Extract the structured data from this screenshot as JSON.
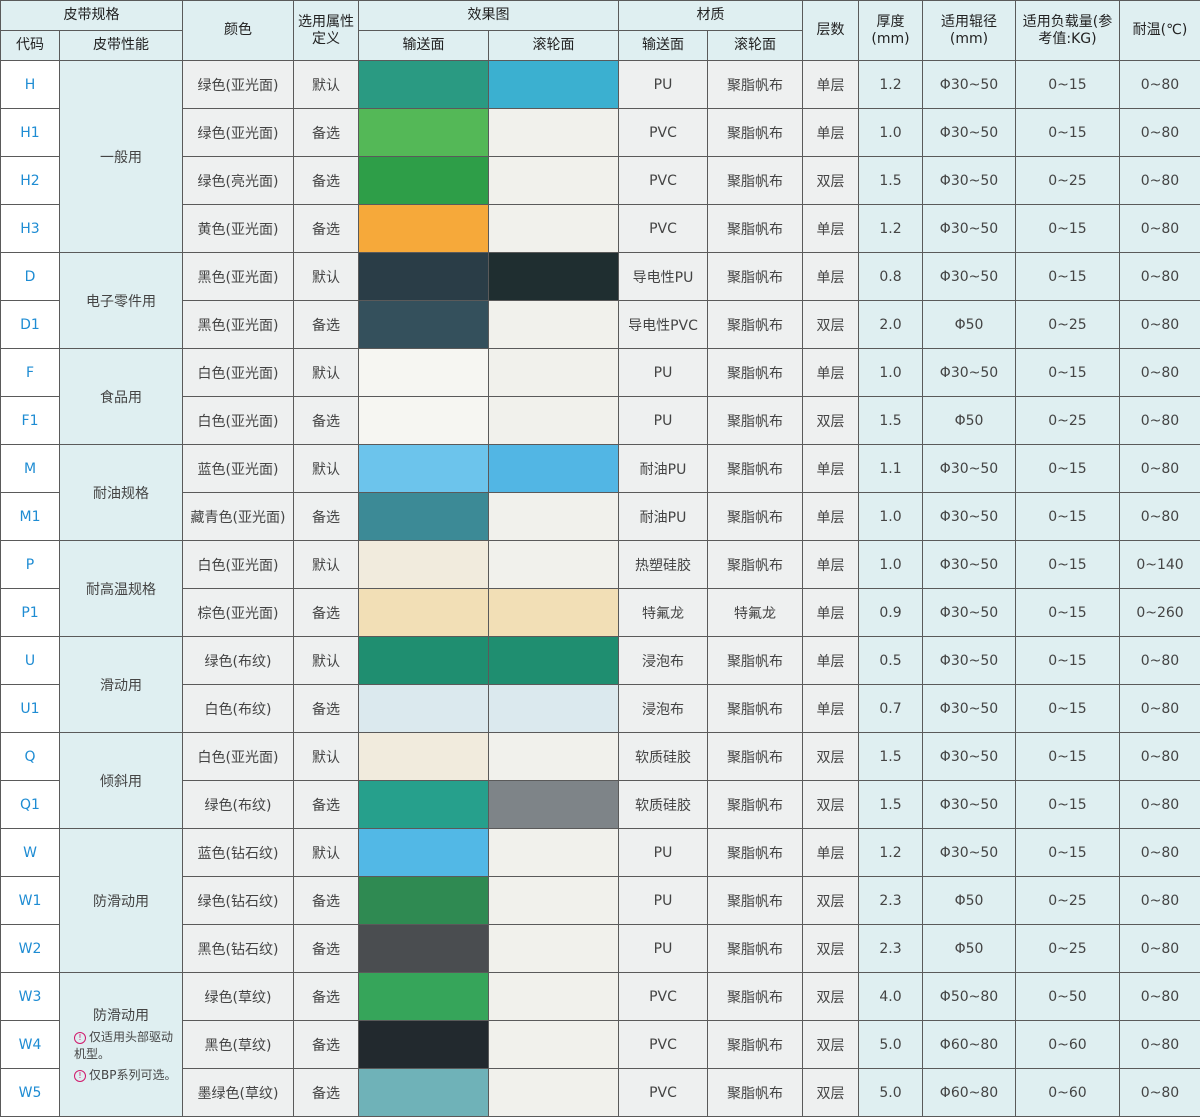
{
  "header": {
    "spec": "皮带规格",
    "code": "代码",
    "performance": "皮带性能",
    "color": "颜色",
    "attr": "选用属性定义",
    "effect": "效果图",
    "effect_conv": "输送面",
    "effect_roll": "滚轮面",
    "material": "材质",
    "mat_conv": "输送面",
    "mat_roll": "滚轮面",
    "layers": "层数",
    "thickness": "厚度(mm)",
    "radius": "适用辊径(mm)",
    "load": "适用负载量(参考值:KG)",
    "temp": "耐温(℃)"
  },
  "groups": [
    {
      "label": "一般用"
    },
    {
      "label": "电子零件用"
    },
    {
      "label": "食品用"
    },
    {
      "label": "耐油规格"
    },
    {
      "label": "耐高温规格"
    },
    {
      "label": "滑动用"
    },
    {
      "label": "倾斜用"
    },
    {
      "label": "防滑动用"
    },
    {
      "label": "防滑动用",
      "notes": [
        "仅适用头部驱动机型。",
        "仅BP系列可选。"
      ]
    }
  ],
  "rows": [
    {
      "code": "H",
      "color": "绿色(亚光面)",
      "attr": "默认",
      "mat_conv": "PU",
      "mat_roll": "聚脂帆布",
      "layers": "单层",
      "thickness": "1.2",
      "radius": "Φ30~50",
      "load": "0~15",
      "temp": "0~80",
      "sw_conv": "#2a9a82",
      "sw_roll": "#3bb0d0"
    },
    {
      "code": "H1",
      "color": "绿色(亚光面)",
      "attr": "备选",
      "mat_conv": "PVC",
      "mat_roll": "聚脂帆布",
      "layers": "单层",
      "thickness": "1.0",
      "radius": "Φ30~50",
      "load": "0~15",
      "temp": "0~80",
      "sw_conv": "#54b857",
      "sw_roll": "#f1f1ec"
    },
    {
      "code": "H2",
      "color": "绿色(亮光面)",
      "attr": "备选",
      "mat_conv": "PVC",
      "mat_roll": "聚脂帆布",
      "layers": "双层",
      "thickness": "1.5",
      "radius": "Φ30~50",
      "load": "0~25",
      "temp": "0~80",
      "sw_conv": "#2e9e48",
      "sw_roll": "#f1f1ec"
    },
    {
      "code": "H3",
      "color": "黄色(亚光面)",
      "attr": "备选",
      "mat_conv": "PVC",
      "mat_roll": "聚脂帆布",
      "layers": "单层",
      "thickness": "1.2",
      "radius": "Φ30~50",
      "load": "0~15",
      "temp": "0~80",
      "sw_conv": "#f6a93a",
      "sw_roll": "#f1f1ec"
    },
    {
      "code": "D",
      "color": "黑色(亚光面)",
      "attr": "默认",
      "mat_conv": "导电性PU",
      "mat_roll": "聚脂帆布",
      "layers": "单层",
      "thickness": "0.8",
      "radius": "Φ30~50",
      "load": "0~15",
      "temp": "0~80",
      "sw_conv": "#2a3d47",
      "sw_roll": "#1f2e30"
    },
    {
      "code": "D1",
      "color": "黑色(亚光面)",
      "attr": "备选",
      "mat_conv": "导电性PVC",
      "mat_roll": "聚脂帆布",
      "layers": "双层",
      "thickness": "2.0",
      "radius": "Φ50",
      "load": "0~25",
      "temp": "0~80",
      "sw_conv": "#34505c",
      "sw_roll": "#f1f1ec"
    },
    {
      "code": "F",
      "color": "白色(亚光面)",
      "attr": "默认",
      "mat_conv": "PU",
      "mat_roll": "聚脂帆布",
      "layers": "单层",
      "thickness": "1.0",
      "radius": "Φ30~50",
      "load": "0~15",
      "temp": "0~80",
      "sw_conv": "#f6f6f2",
      "sw_roll": "#f1f1ec"
    },
    {
      "code": "F1",
      "color": "白色(亚光面)",
      "attr": "备选",
      "mat_conv": "PU",
      "mat_roll": "聚脂帆布",
      "layers": "双层",
      "thickness": "1.5",
      "radius": "Φ50",
      "load": "0~25",
      "temp": "0~80",
      "sw_conv": "#f6f6f2",
      "sw_roll": "#f1f1ec"
    },
    {
      "code": "M",
      "color": "蓝色(亚光面)",
      "attr": "默认",
      "mat_conv": "耐油PU",
      "mat_roll": "聚脂帆布",
      "layers": "单层",
      "thickness": "1.1",
      "radius": "Φ30~50",
      "load": "0~15",
      "temp": "0~80",
      "sw_conv": "#6cc4ec",
      "sw_roll": "#52b6e4"
    },
    {
      "code": "M1",
      "color": "藏青色(亚光面)",
      "attr": "备选",
      "mat_conv": "耐油PU",
      "mat_roll": "聚脂帆布",
      "layers": "单层",
      "thickness": "1.0",
      "radius": "Φ30~50",
      "load": "0~15",
      "temp": "0~80",
      "sw_conv": "#3c8a96",
      "sw_roll": "#f1f1ec"
    },
    {
      "code": "P",
      "color": "白色(亚光面)",
      "attr": "默认",
      "mat_conv": "热塑硅胶",
      "mat_roll": "聚脂帆布",
      "layers": "单层",
      "thickness": "1.0",
      "radius": "Φ30~50",
      "load": "0~15",
      "temp": "0~140",
      "sw_conv": "#f1ebdd",
      "sw_roll": "#f1f1ec"
    },
    {
      "code": "P1",
      "color": "棕色(亚光面)",
      "attr": "备选",
      "mat_conv": "特氟龙",
      "mat_roll": "特氟龙",
      "layers": "单层",
      "thickness": "0.9",
      "radius": "Φ30~50",
      "load": "0~15",
      "temp": "0~260",
      "sw_conv": "#f2dfb6",
      "sw_roll": "#f2dfb6"
    },
    {
      "code": "U",
      "color": "绿色(布纹)",
      "attr": "默认",
      "mat_conv": "浸泡布",
      "mat_roll": "聚脂帆布",
      "layers": "单层",
      "thickness": "0.5",
      "radius": "Φ30~50",
      "load": "0~15",
      "temp": "0~80",
      "sw_conv": "#1f8e70",
      "sw_roll": "#1f8e70"
    },
    {
      "code": "U1",
      "color": "白色(布纹)",
      "attr": "备选",
      "mat_conv": "浸泡布",
      "mat_roll": "聚脂帆布",
      "layers": "单层",
      "thickness": "0.7",
      "radius": "Φ30~50",
      "load": "0~15",
      "temp": "0~80",
      "sw_conv": "#dbe9ee",
      "sw_roll": "#dbe9ee"
    },
    {
      "code": "Q",
      "color": "白色(亚光面)",
      "attr": "默认",
      "mat_conv": "软质硅胶",
      "mat_roll": "聚脂帆布",
      "layers": "双层",
      "thickness": "1.5",
      "radius": "Φ30~50",
      "load": "0~15",
      "temp": "0~80",
      "sw_conv": "#f1ebdd",
      "sw_roll": "#f1f1ec"
    },
    {
      "code": "Q1",
      "color": "绿色(布纹)",
      "attr": "备选",
      "mat_conv": "软质硅胶",
      "mat_roll": "聚脂帆布",
      "layers": "双层",
      "thickness": "1.5",
      "radius": "Φ30~50",
      "load": "0~15",
      "temp": "0~80",
      "sw_conv": "#26a08c",
      "sw_roll": "#7e8488"
    },
    {
      "code": "W",
      "color": "蓝色(钻石纹)",
      "attr": "默认",
      "mat_conv": "PU",
      "mat_roll": "聚脂帆布",
      "layers": "单层",
      "thickness": "1.2",
      "radius": "Φ30~50",
      "load": "0~15",
      "temp": "0~80",
      "sw_conv": "#52b8e6",
      "sw_roll": "#f1f1ec"
    },
    {
      "code": "W1",
      "color": "绿色(钻石纹)",
      "attr": "备选",
      "mat_conv": "PU",
      "mat_roll": "聚脂帆布",
      "layers": "双层",
      "thickness": "2.3",
      "radius": "Φ50",
      "load": "0~25",
      "temp": "0~80",
      "sw_conv": "#2f8a52",
      "sw_roll": "#f1f1ec"
    },
    {
      "code": "W2",
      "color": "黑色(钻石纹)",
      "attr": "备选",
      "mat_conv": "PU",
      "mat_roll": "聚脂帆布",
      "layers": "双层",
      "thickness": "2.3",
      "radius": "Φ50",
      "load": "0~25",
      "temp": "0~80",
      "sw_conv": "#4a4d50",
      "sw_roll": "#f1f1ec"
    },
    {
      "code": "W3",
      "color": "绿色(草纹)",
      "attr": "备选",
      "mat_conv": "PVC",
      "mat_roll": "聚脂帆布",
      "layers": "双层",
      "thickness": "4.0",
      "radius": "Φ50~80",
      "load": "0~50",
      "temp": "0~80",
      "sw_conv": "#36a55a",
      "sw_roll": "#f1f1ec"
    },
    {
      "code": "W4",
      "color": "黑色(草纹)",
      "attr": "备选",
      "mat_conv": "PVC",
      "mat_roll": "聚脂帆布",
      "layers": "双层",
      "thickness": "5.0",
      "radius": "Φ60~80",
      "load": "0~60",
      "temp": "0~80",
      "sw_conv": "#22292e",
      "sw_roll": "#f1f1ec"
    },
    {
      "code": "W5",
      "color": "墨绿色(草纹)",
      "attr": "备选",
      "mat_conv": "PVC",
      "mat_roll": "聚脂帆布",
      "layers": "双层",
      "thickness": "5.0",
      "radius": "Φ60~80",
      "load": "0~60",
      "temp": "0~80",
      "sw_conv": "#6fb2b8",
      "sw_roll": "#f1f1ec"
    }
  ],
  "colors": {
    "header_bg": "#dfeff1",
    "cyan_cell": "#dfeff1",
    "grey_cell": "#eef0f0",
    "code_text": "#1e8cd3",
    "note_icon": "#d01a6c"
  }
}
